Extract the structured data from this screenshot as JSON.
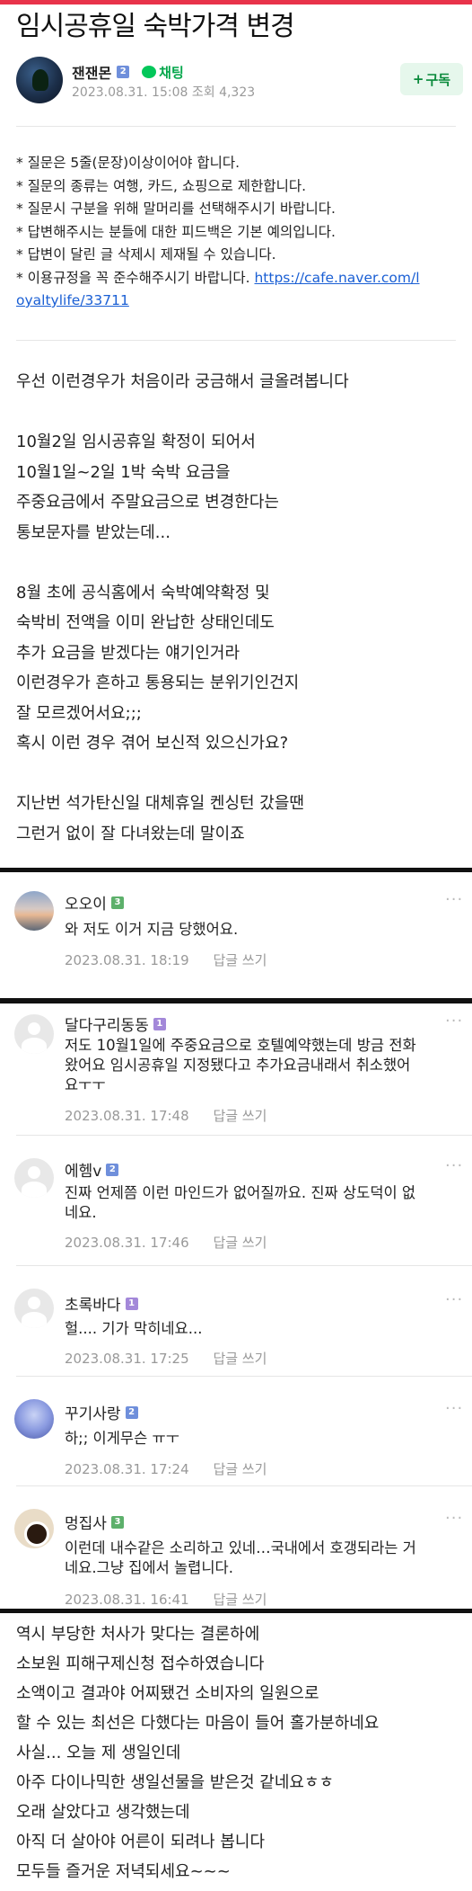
{
  "post": {
    "title": "임시공휴일 숙박가격 변경",
    "author": "잰잰몬",
    "author_level": "2",
    "chat_label": "채팅",
    "date": "2023.08.31. 15:08",
    "views": "조회 4,323",
    "subscribe_label": "구독",
    "notice": [
      "* 질문은 5줄(문장)이상이어야 합니다.",
      "* 질문의 종류는 여행, 카드, 쇼핑으로 제한합니다.",
      "* 질문시 구분을 위해 말머리를 선택해주시기 바랍니다.",
      "* 답변해주시는 분들에 대한 피드백은 기본 예의입니다.",
      "* 답변이 달린 글 삭제시 제재될 수 있습니다.",
      "* 이용규정을 꼭 준수해주시기 바랍니다."
    ],
    "notice_link_part1": "https://cafe.naver.com/l",
    "notice_link_part2": "oyaltylife/33711",
    "body_lines": [
      "우선 이런경우가 처음이라 궁금해서 글올려봅니다",
      "",
      "10월2일 임시공휴일 확정이 되어서",
      "10월1일~2일 1박 숙박 요금을",
      "주중요금에서 주말요금으로 변경한다는",
      "통보문자를 받았는데...",
      "",
      "8월 초에 공식홈에서 숙박예약확정 및",
      "숙박비 전액을 이미 완납한 상태인데도",
      "추가 요금을 받겠다는 얘기인거라",
      "이런경우가 흔하고 통용되는 분위기인건지",
      "잘 모르겠어서요;;;",
      "혹시 이런 경우 겪어 보신적 있으신가요?",
      "",
      "지난번 석가탄신일 대체휴일 켄싱턴 갔을땐",
      "그런거 없이 잘 다녀왔는데 말이죠"
    ]
  },
  "comments": [
    {
      "nick": "오오이",
      "level": "3",
      "text": [
        "와 저도 이거 지금 당했어요."
      ],
      "date": "2023.08.31. 18:19",
      "reply": "답글 쓰기"
    },
    {
      "nick": "달다구리동동",
      "level": "1",
      "text": [
        "저도 10월1일에 주중요금으로 호텔예약했는데 방금 전화",
        "왔어요 임시공휴일 지정됐다고 추가요금내래서 취소했어",
        "요ㅜㅜ"
      ],
      "date": "2023.08.31. 17:48",
      "reply": "답글 쓰기"
    },
    {
      "nick": "에헴v",
      "level": "2",
      "text": [
        "진짜 언제쯤 이런 마인드가 없어질까요. 진짜 상도덕이 없",
        "네요."
      ],
      "date": "2023.08.31. 17:46",
      "reply": "답글 쓰기"
    },
    {
      "nick": "초록바다",
      "level": "1",
      "text": [
        "헐.... 기가 막히네요..."
      ],
      "date": "2023.08.31. 17:25",
      "reply": "답글 쓰기"
    },
    {
      "nick": "꾸기사랑",
      "level": "2",
      "text": [
        "하;; 이게무슨 ㅠㅜ"
      ],
      "date": "2023.08.31. 17:24",
      "reply": "답글 쓰기"
    },
    {
      "nick": "멍집사",
      "level": "3",
      "text": [
        "이런데 내수같은 소리하고 있네…국내에서 호갱되라는 거",
        "네요.그냥 집에서 놀렵니다."
      ],
      "date": "2023.08.31. 16:41",
      "reply": "답글 쓰기"
    }
  ],
  "more_label": "···",
  "followup_lines": [
    "역시 부당한 처사가 맞다는 결론하에",
    "소보원 피해구제신청 접수하였습니다",
    "소액이고 결과야 어찌됐건 소비자의 일원으로",
    "할 수 있는 최선은 다했다는 마음이 들어 홀가분하네요",
    "사실... 오늘 제 생일인데",
    "아주 다이나믹한 생일선물을 받은것 같네요ㅎㅎ",
    "오래 살았다고 생각했는데",
    "아직 더 살아야 어른이 되려나 봅니다",
    "모두들 즐거운 저녁되세요~~~"
  ]
}
